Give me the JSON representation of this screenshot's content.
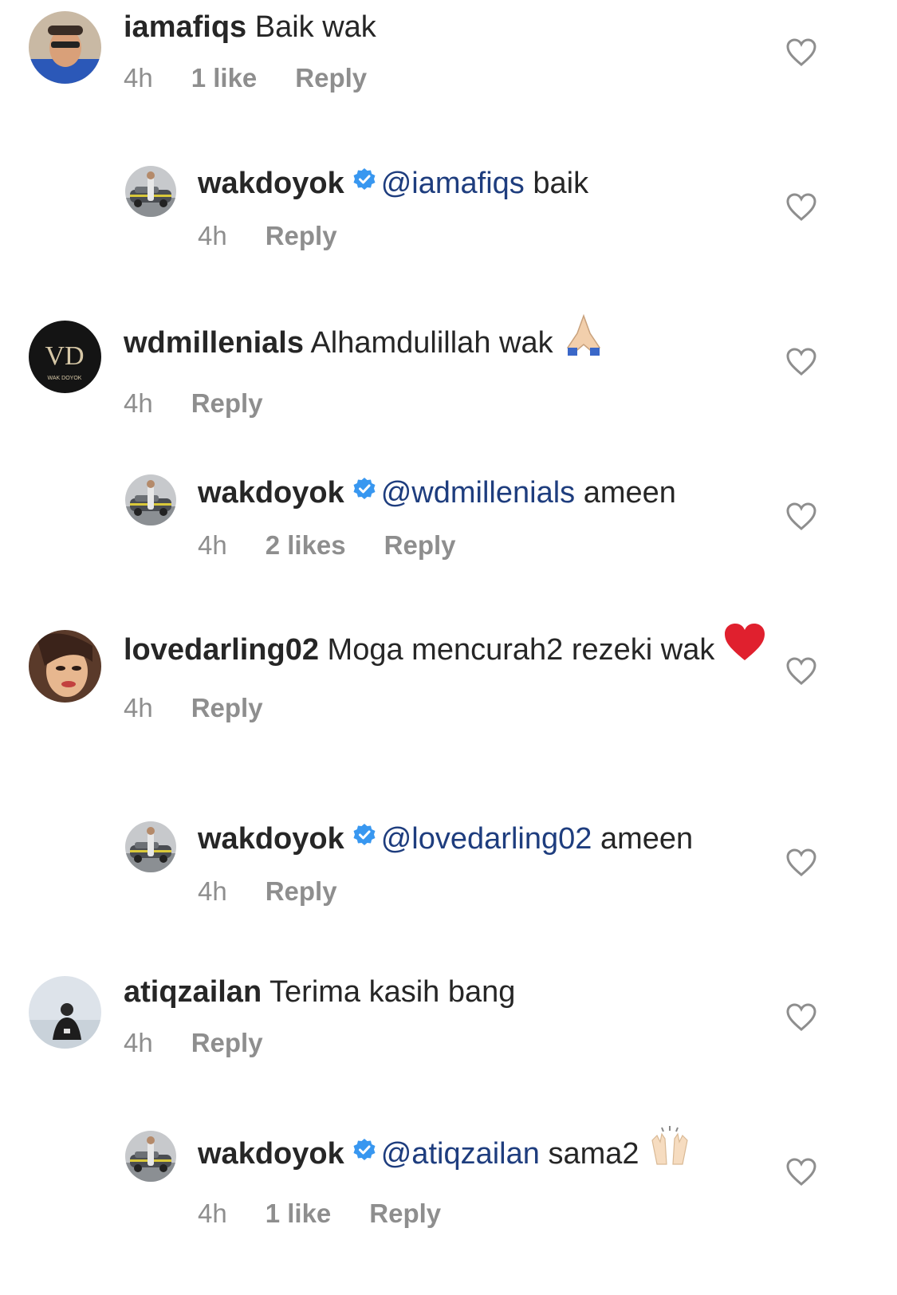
{
  "comments": [
    {
      "kind": "top",
      "avatar": "avatar-glasses",
      "user": "iamafiqs",
      "mention": "",
      "text": "Baik wak",
      "time": "4h",
      "likes": "1 like",
      "reply": "Reply",
      "emoji": ""
    },
    {
      "kind": "reply",
      "avatar": "avatar-car",
      "user": "wakdoyok",
      "verified": true,
      "mention": "@iamafiqs",
      "text": "baik",
      "time": "4h",
      "likes": "",
      "reply": "Reply",
      "emoji": ""
    },
    {
      "kind": "top",
      "avatar": "avatar-vd-logo",
      "user": "wdmillenials",
      "mention": "",
      "text": "Alhamdulillah  wak",
      "time": "4h",
      "likes": "",
      "reply": "Reply",
      "emoji": "folded-hands"
    },
    {
      "kind": "reply",
      "avatar": "avatar-car",
      "user": "wakdoyok",
      "verified": true,
      "mention": "@wdmillenials",
      "text": "ameen",
      "time": "4h",
      "likes": "2 likes",
      "reply": "Reply",
      "emoji": ""
    },
    {
      "kind": "top",
      "avatar": "avatar-woman",
      "user": "lovedarling02",
      "mention": "",
      "text": "Moga mencurah2 rezeki wak",
      "time": "4h",
      "likes": "",
      "reply": "Reply",
      "emoji": "red-heart"
    },
    {
      "kind": "reply",
      "avatar": "avatar-car",
      "user": "wakdoyok",
      "verified": true,
      "mention": "@lovedarling02",
      "text": "ameen",
      "time": "4h",
      "likes": "",
      "reply": "Reply",
      "emoji": ""
    },
    {
      "kind": "top",
      "avatar": "avatar-person",
      "user": "atiqzailan",
      "mention": "",
      "text": "Terima kasih bang",
      "time": "4h",
      "likes": "",
      "reply": "Reply",
      "emoji": ""
    },
    {
      "kind": "reply",
      "avatar": "avatar-car",
      "user": "wakdoyok",
      "verified": true,
      "mention": "@atiqzailan",
      "text": "sama2",
      "time": "4h",
      "likes": "1 like",
      "reply": "Reply",
      "emoji": "raising-hands"
    }
  ],
  "colors": {
    "text": "#262626",
    "meta": "#8e8e8e",
    "mention": "#1e3d7e",
    "verified": "#3897f0"
  }
}
